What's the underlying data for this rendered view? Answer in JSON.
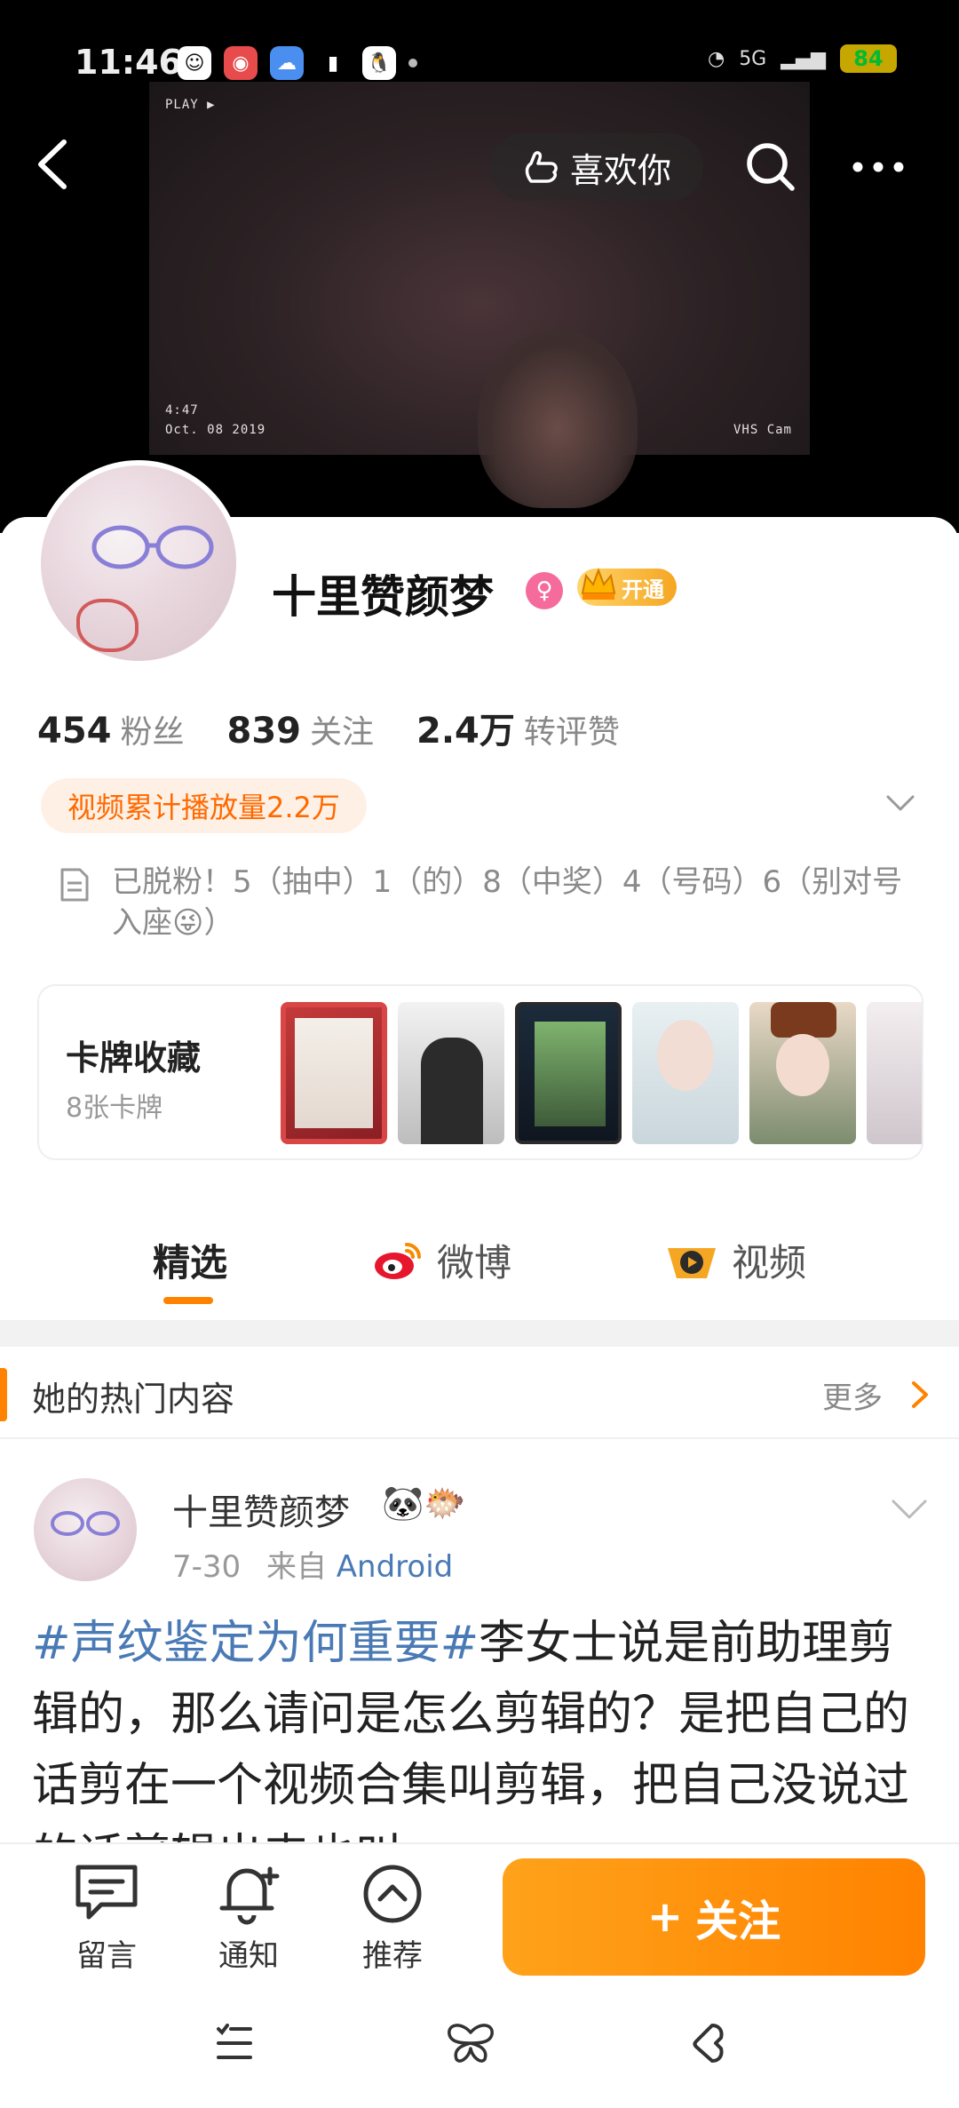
{
  "status_bar": {
    "time": "11:46",
    "network": "5G",
    "battery": "84"
  },
  "cover": {
    "vhs_play": "PLAY ▶",
    "vhs_time": "4:47",
    "vhs_date": "Oct. 08 2019",
    "vhs_cam": "VHS Cam"
  },
  "header": {
    "like_label": "喜欢你"
  },
  "profile": {
    "name": "十里赞颜梦",
    "vip_label": "开通",
    "stats": [
      {
        "value": "454",
        "label": "粉丝"
      },
      {
        "value": "839",
        "label": "关注"
      },
      {
        "value": "2.4万",
        "label": "转评赞"
      }
    ],
    "play_count": "视频累计播放量2.2万",
    "bio": "已脱粉！5（抽中）1（的）8（中奖）4（号码）6（别对号入座😜）"
  },
  "cards": {
    "title": "卡牌收藏",
    "count": "8张卡牌"
  },
  "tabs": [
    {
      "label": "精选",
      "active": true
    },
    {
      "label": "微博",
      "active": false
    },
    {
      "label": "视频",
      "active": false
    }
  ],
  "hot": {
    "title": "她的热门内容",
    "more": "更多"
  },
  "post": {
    "author": "十里赞颜梦",
    "emojis": "🐼🐡",
    "date": "7-30",
    "from_label": "来自",
    "source": "Android",
    "hashtag": "#声纹鉴定为何重要#",
    "text": "李女士说是前助理剪辑的，那么请问是怎么剪辑的？是把自己的话剪在一个视频合集叫剪辑，把自己没说过的话剪辑出来也叫"
  },
  "actions": [
    {
      "label": "留言",
      "icon": "comment-icon"
    },
    {
      "label": "通知",
      "icon": "bell-plus-icon"
    },
    {
      "label": "推荐",
      "icon": "chevron-up-circle-icon"
    }
  ],
  "follow": {
    "label": "关注",
    "plus": "+"
  },
  "colors": {
    "accent": "#ff8200",
    "link": "#4a7ab5"
  }
}
